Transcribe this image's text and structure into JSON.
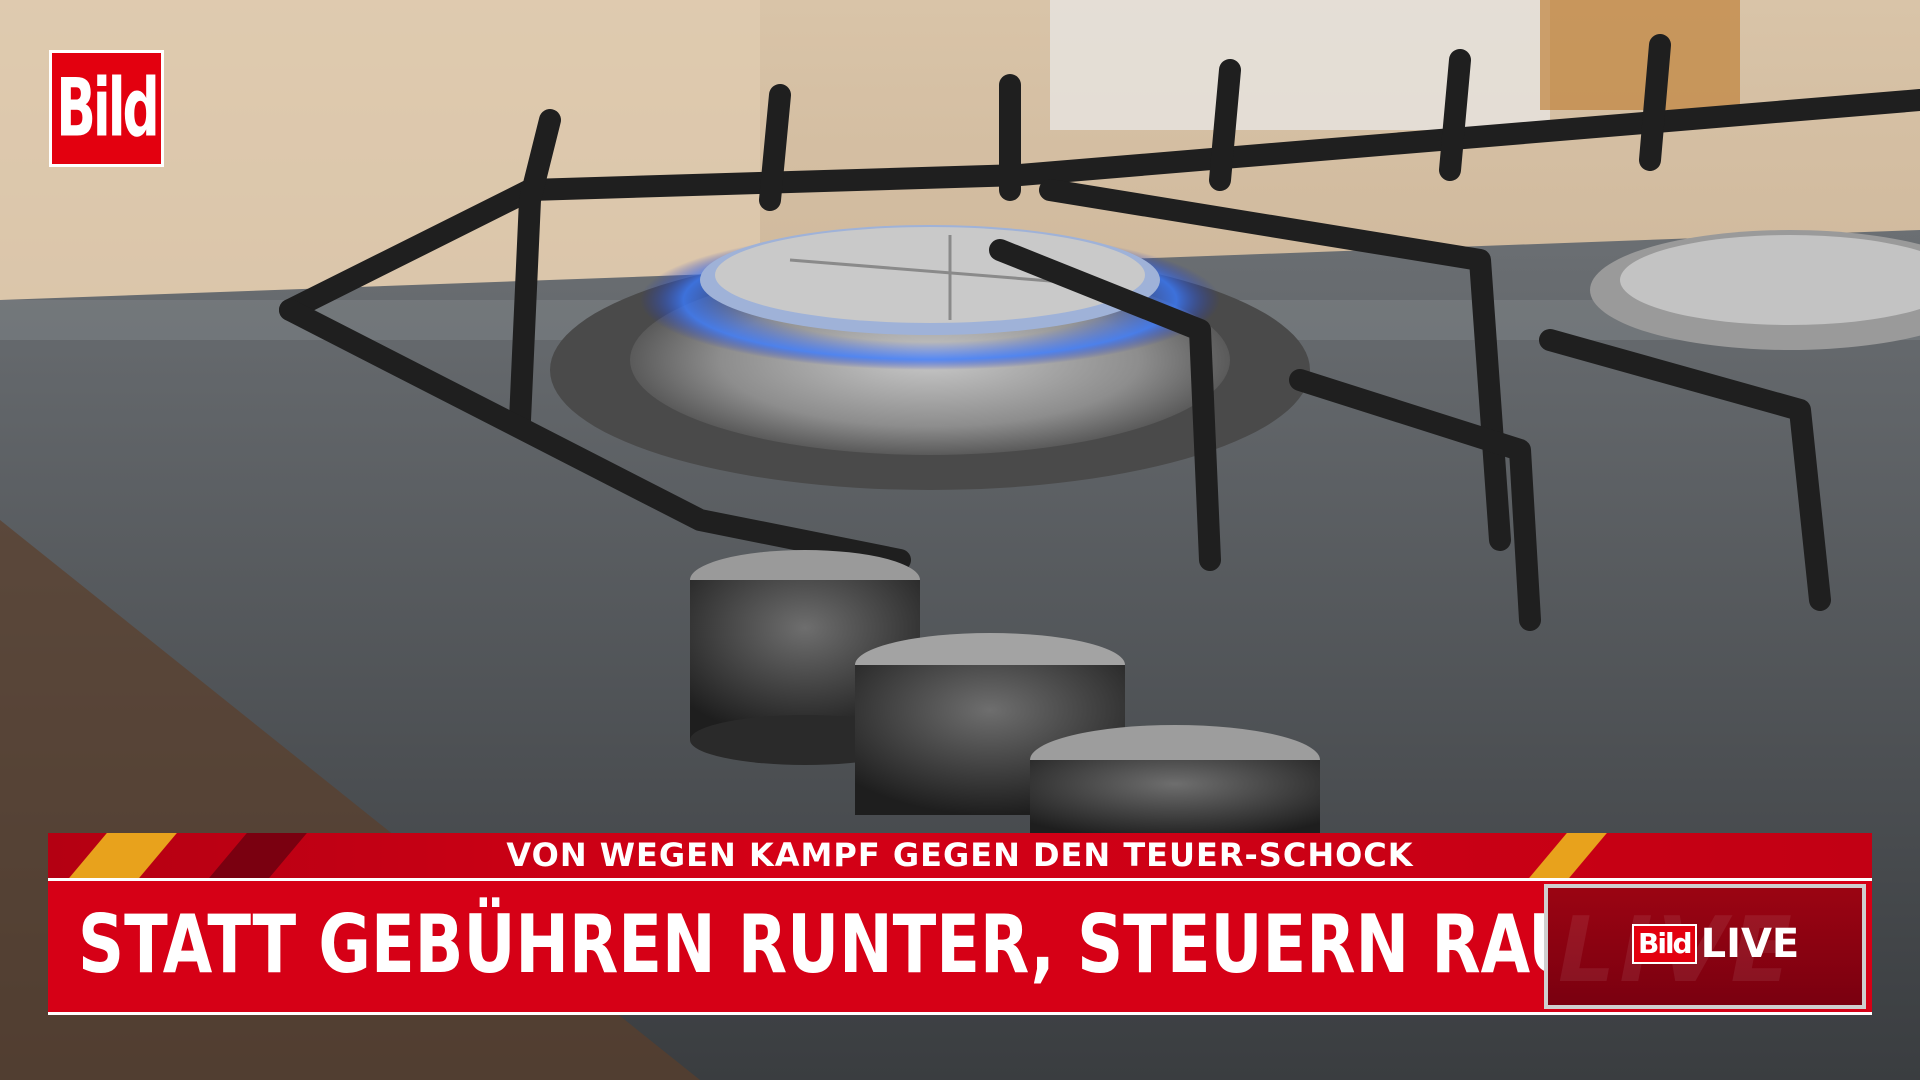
{
  "channel_logo": {
    "text": "Bild",
    "color": "#e3000f"
  },
  "lower_third": {
    "kicker": "VON WEGEN KAMPF GEGEN DEN TEUER-SCHOCK",
    "headline": "STATT GEBÜHREN RUNTER, STEUERN RAUF!",
    "accent_color": "#d60016"
  },
  "live_badge": {
    "bild_text": "Bild",
    "live_text": "LIVE"
  }
}
